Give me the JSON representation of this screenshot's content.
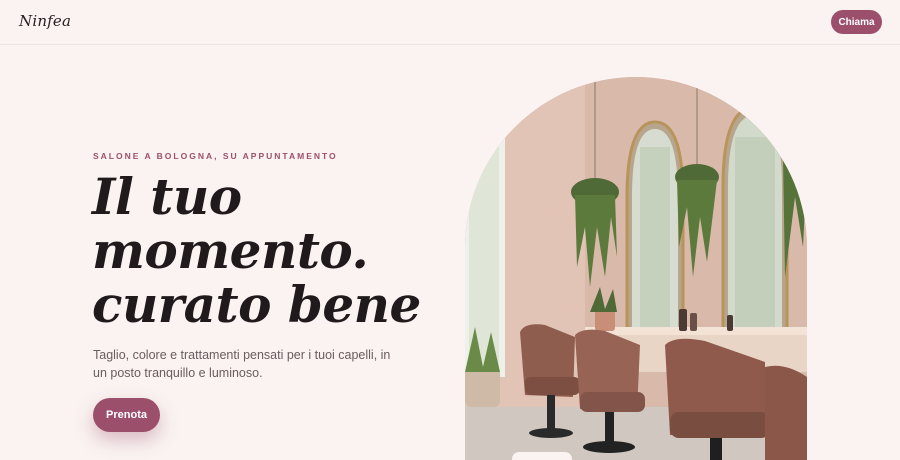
{
  "header": {
    "logo": "Ninfea",
    "call_label": "Chiama"
  },
  "hero": {
    "eyebrow": "SALONE A BOLOGNA, SU APPUNTAMENTO",
    "headline_lines": [
      "Il tuo",
      "momento.",
      "curato bene"
    ],
    "subtitle": "Taglio, colore e trattamenti pensati per i tuoi capelli, in un posto tranquillo e luminoso.",
    "cta_label": "Prenota"
  },
  "colors": {
    "background": "#faf3f2",
    "accent": "#9c4f6b",
    "headline": "#201a1c",
    "body_text": "#6b5c5f"
  }
}
